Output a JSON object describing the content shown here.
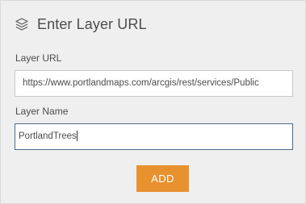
{
  "header": {
    "icon": "layers-icon",
    "title": "Enter Layer URL"
  },
  "form": {
    "url_label": "Layer URL",
    "url_value": "https://www.portlandmaps.com/arcgis/rest/services/Public",
    "name_label": "Layer Name",
    "name_value": "PortlandTrees"
  },
  "actions": {
    "add_label": "ADD"
  },
  "colors": {
    "background": "#efefef",
    "accent": "#e8912f",
    "focus_border": "#4a6d8c",
    "text": "#4c4c4c"
  }
}
